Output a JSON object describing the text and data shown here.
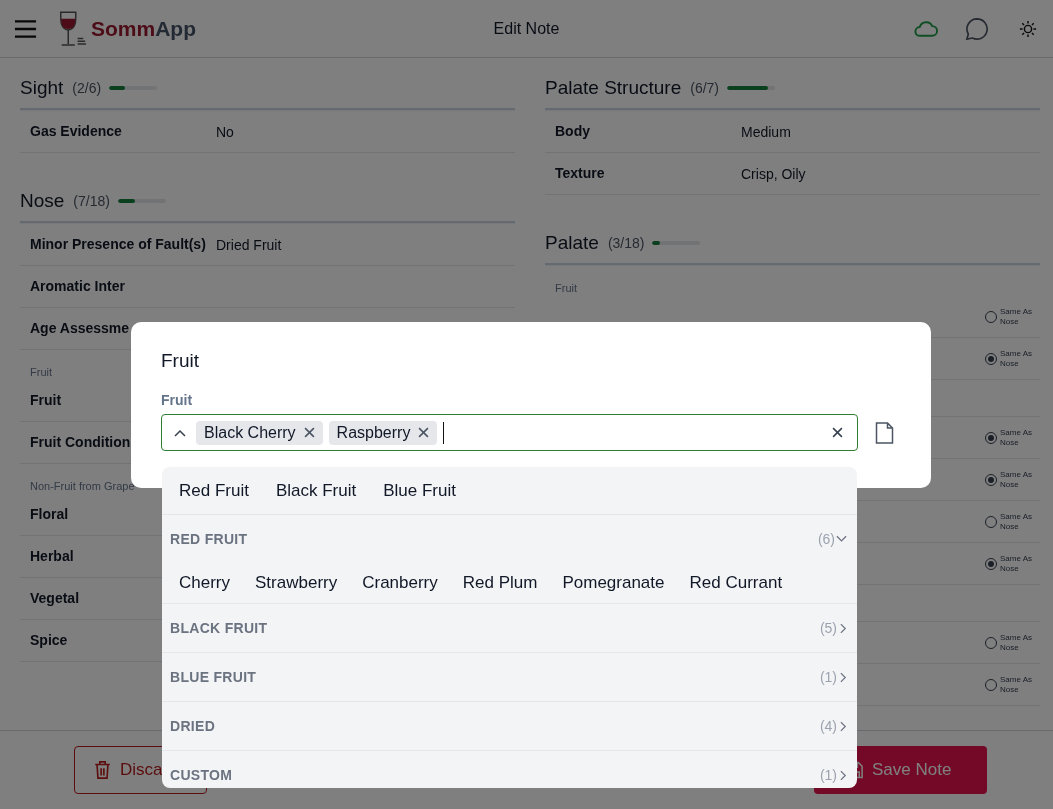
{
  "header": {
    "brand_primary": "Somm",
    "brand_secondary": "App",
    "title": "Edit Note"
  },
  "left_sections": [
    {
      "title": "Sight",
      "count": "(2/6)",
      "level": 0.33,
      "rows": [
        {
          "kind": "field",
          "label": "Gas Evidence",
          "value": "No"
        }
      ]
    },
    {
      "title": "Nose",
      "count": "(7/18)",
      "level": 0.36,
      "rows": [
        {
          "kind": "field",
          "label": "Minor Presence of Fault(s)",
          "value": "Dried Fruit"
        },
        {
          "kind": "field",
          "label": "Aromatic Inter"
        },
        {
          "kind": "field",
          "label": "Age Assessme"
        },
        {
          "kind": "subheader",
          "label": "Fruit"
        },
        {
          "kind": "field",
          "label": "Fruit"
        },
        {
          "kind": "field",
          "label": "Fruit Condition"
        },
        {
          "kind": "subheader",
          "label": "Non-Fruit from Grape"
        },
        {
          "kind": "field",
          "label": "Floral"
        },
        {
          "kind": "field",
          "label": "Herbal"
        },
        {
          "kind": "field",
          "label": "Vegetal"
        },
        {
          "kind": "field",
          "label": "Spice"
        }
      ]
    }
  ],
  "right_sections": [
    {
      "title": "Palate Structure",
      "count": "(6/7)",
      "level": 0.85,
      "rows": [
        {
          "kind": "field",
          "label": "Body",
          "value": "Medium"
        },
        {
          "kind": "field",
          "label": "Texture",
          "value": "Crisp, Oily"
        }
      ]
    },
    {
      "title": "Palate",
      "count": "(3/18)",
      "level": 0.15,
      "rows": [
        {
          "kind": "subheader",
          "label": "Fruit"
        },
        {
          "kind": "field",
          "same_as_nose": {
            "label": "Same As Nose",
            "checked": false
          }
        },
        {
          "kind": "field",
          "same_as_nose": {
            "label": "Same As Nose",
            "checked": true
          }
        },
        {
          "kind": "gap"
        },
        {
          "kind": "field",
          "same_as_nose": {
            "label": "Same As Nose",
            "checked": true
          }
        },
        {
          "kind": "field",
          "same_as_nose": {
            "label": "Same As Nose",
            "checked": true
          }
        },
        {
          "kind": "field",
          "same_as_nose": {
            "label": "Same As Nose",
            "checked": false
          }
        },
        {
          "kind": "field",
          "same_as_nose": {
            "label": "Same As Nose",
            "checked": true
          }
        },
        {
          "kind": "gap"
        },
        {
          "kind": "field",
          "same_as_nose": {
            "label": "Same As Nose",
            "checked": false
          }
        },
        {
          "kind": "field",
          "same_as_nose": {
            "label": "Same As Nose",
            "checked": false
          }
        }
      ]
    }
  ],
  "footer": {
    "buttons": [
      {
        "kind": "discard",
        "label": "Disca"
      },
      {
        "kind": "save",
        "label": "Save Note"
      }
    ]
  },
  "modal": {
    "title": "Fruit",
    "field_label": "Fruit",
    "chips": [
      "Black Cherry",
      "Raspberry"
    ],
    "dropdown": {
      "quick_options": [
        "Red Fruit",
        "Black Fruit",
        "Blue Fruit"
      ],
      "groups": [
        {
          "label": "RED FRUIT",
          "count": "(6)",
          "expanded": true,
          "items": [
            "Cherry",
            "Strawberry",
            "Cranberry",
            "Red Plum",
            "Pomegranate",
            "Red Currant"
          ]
        },
        {
          "label": "BLACK FRUIT",
          "count": "(5)",
          "expanded": false
        },
        {
          "label": "BLUE FRUIT",
          "count": "(1)",
          "expanded": false
        },
        {
          "label": "DRIED",
          "count": "(4)",
          "expanded": false
        },
        {
          "label": "CUSTOM",
          "count": "(1)",
          "expanded": false
        }
      ]
    }
  }
}
